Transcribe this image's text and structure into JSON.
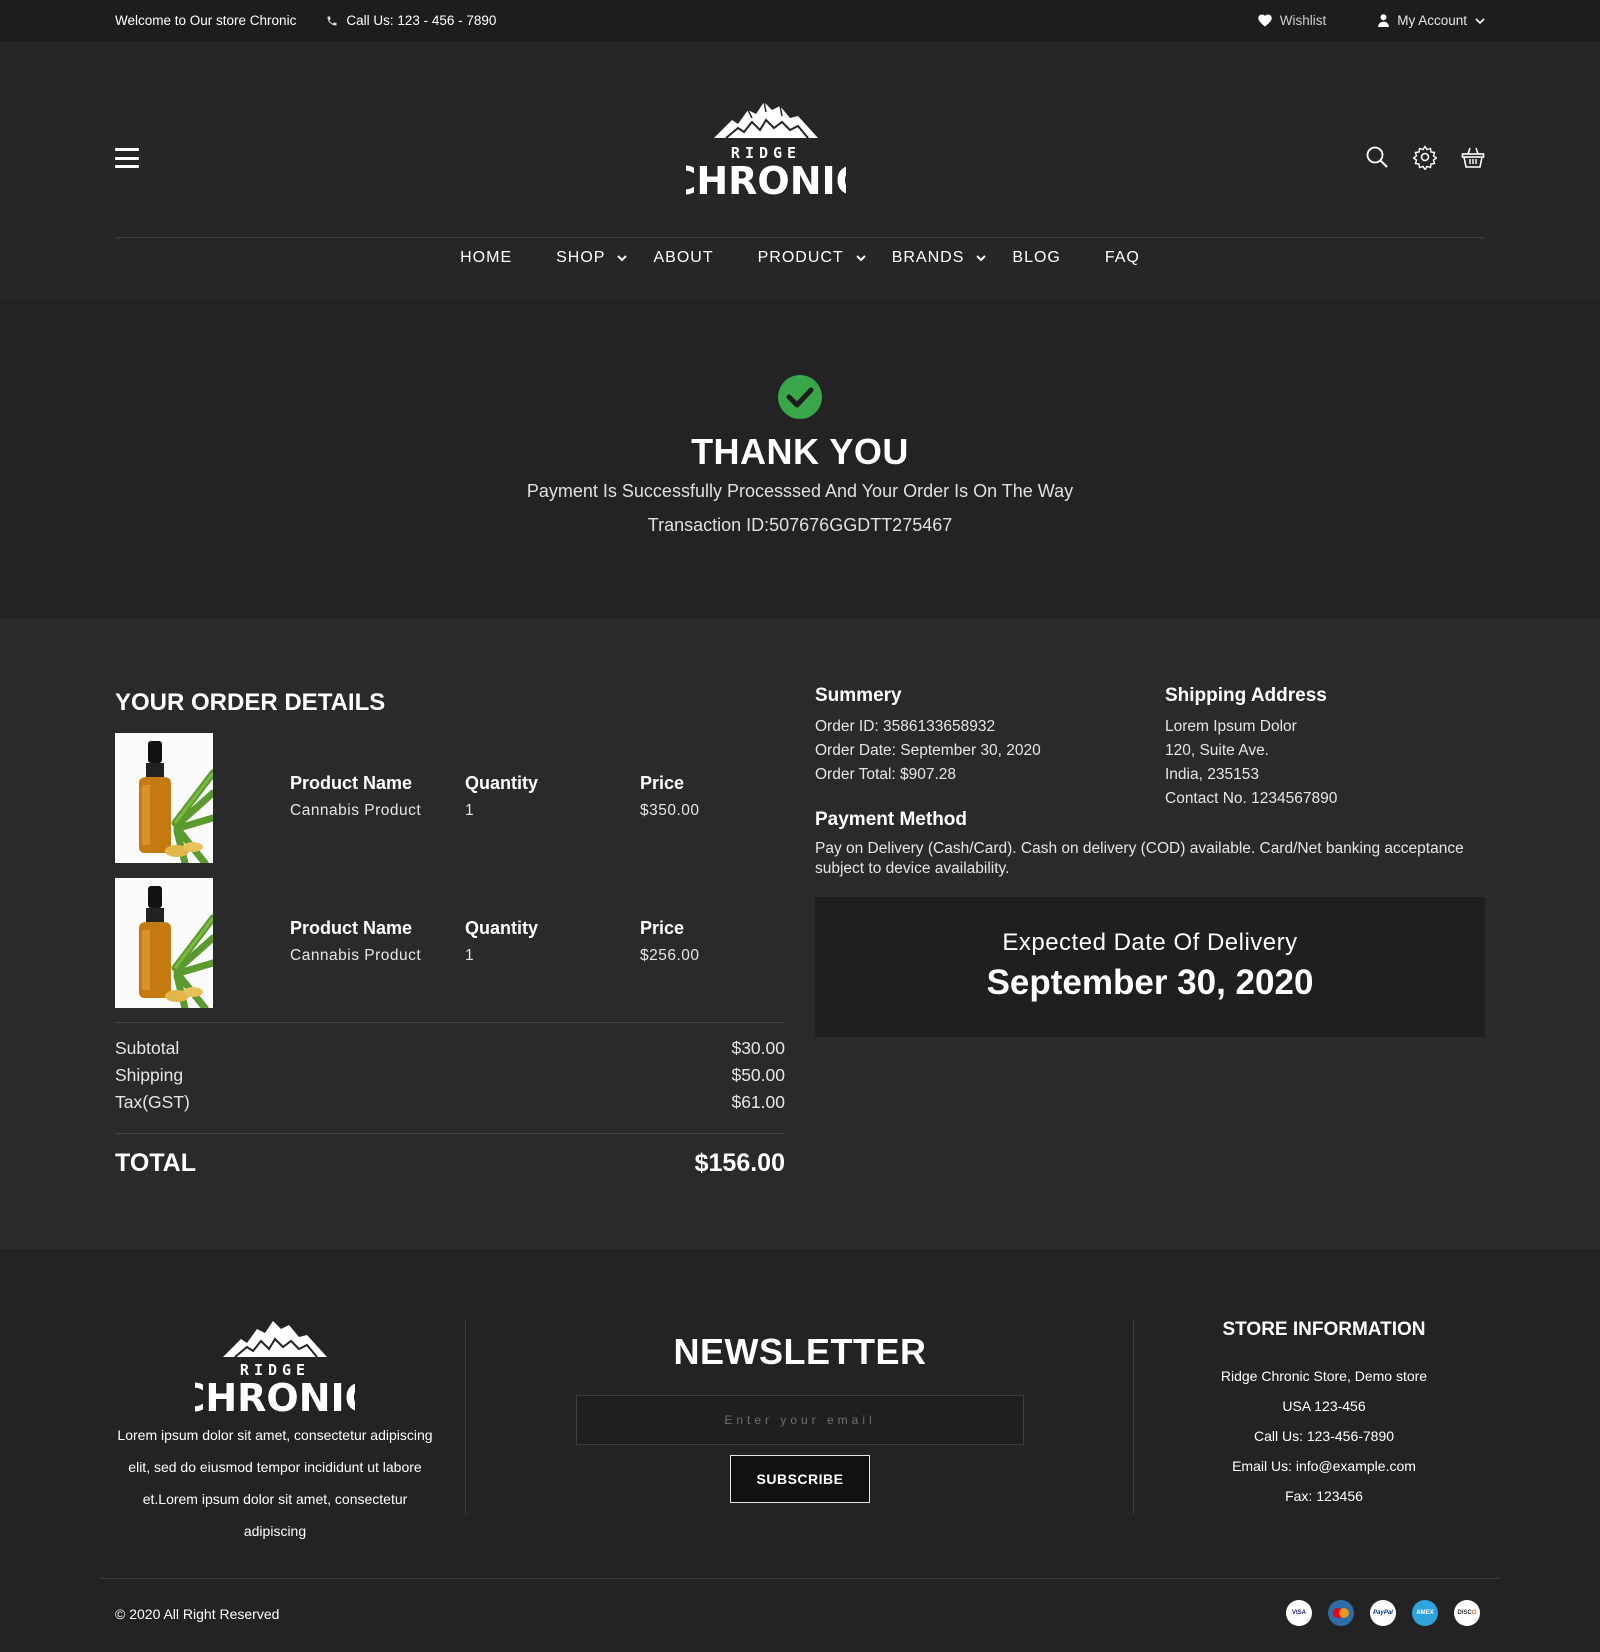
{
  "topbar": {
    "welcome": "Welcome to Our store Chronic",
    "phone": "Call Us: 123 - 456 - 7890",
    "wishlist": "Wishlist",
    "account": "My Account"
  },
  "brand": {
    "line1": "RIDGE",
    "line2": "CHRONIC"
  },
  "nav": [
    "HOME",
    "SHOP",
    "ABOUT",
    "PRODUCT",
    "BRANDS",
    "BLOG",
    "FAQ"
  ],
  "hero": {
    "title": "THANK YOU",
    "message": "Payment Is Successfully Processsed And Your Order Is On The Way",
    "transaction": "Transaction ID:507676GGDTT275467"
  },
  "order": {
    "title": "YOUR ORDER DETAILS",
    "items": [
      {
        "name_label": "Product Name",
        "name": "Cannabis Product",
        "qty_label": "Quantity",
        "qty": "1",
        "price_label": "Price",
        "price": "$350.00"
      },
      {
        "name_label": "Product Name",
        "name": "Cannabis Product",
        "qty_label": "Quantity",
        "qty": "1",
        "price_label": "Price",
        "price": "$256.00"
      }
    ],
    "subtotal_label": "Subtotal",
    "subtotal": "$30.00",
    "shipping_label": "Shipping",
    "shipping": "$50.00",
    "tax_label": "Tax(GST)",
    "tax": "$61.00",
    "total_label": "TOTAL",
    "total": "$156.00"
  },
  "summary": {
    "title": "Summery",
    "order_id": "Order ID: 3586133658932",
    "order_date": "Order Date: September 30, 2020",
    "order_total": "Order Total: $907.28"
  },
  "shipping": {
    "title": "Shipping Address",
    "line1": "Lorem Ipsum Dolor",
    "line2": "120, Suite Ave.",
    "line3": "India, 235153",
    "line4": "Contact No. 1234567890"
  },
  "payment": {
    "title": "Payment Method",
    "text": "Pay on Delivery (Cash/Card). Cash on delivery (COD) available. Card/Net banking acceptance subject to device availability."
  },
  "delivery": {
    "title": "Expected Date Of Delivery",
    "date": "September 30, 2020"
  },
  "footer": {
    "about": "Lorem ipsum dolor sit amet, consectetur adipiscing elit, sed do eiusmod tempor incididunt ut labore et.Lorem ipsum dolor sit amet, consectetur adipiscing",
    "newsletter_title": "NEWSLETTER",
    "email_placeholder": "Enter your email",
    "subscribe": "SUBSCRIBE",
    "store_title": "STORE INFORMATION",
    "store_line1": "Ridge Chronic Store, Demo store",
    "store_line2": "USA 123-456",
    "store_line3": "Call Us: 123-456-7890",
    "store_line4": "Email Us: info@example.com",
    "store_line5": "Fax: 123456",
    "copyright": "© 2020 All Right Reserved",
    "cards": [
      {
        "name": "VISA",
        "color": "#ffffff",
        "fg": "#1a1f71"
      },
      {
        "name": "MC",
        "color": "#2f6ea5",
        "fg": "#f79e1b"
      },
      {
        "name": "PayPal",
        "color": "#ffffff",
        "fg": "#003087"
      },
      {
        "name": "AMEX",
        "color": "#2ea3dc",
        "fg": "#ffffff"
      },
      {
        "name": "DISCOVER",
        "color": "#ffffff",
        "fg": "#e55c20"
      }
    ]
  },
  "colors": {
    "accent_green": "#3aa64a",
    "bg": "#232323",
    "panel": "#2a2a2b"
  }
}
